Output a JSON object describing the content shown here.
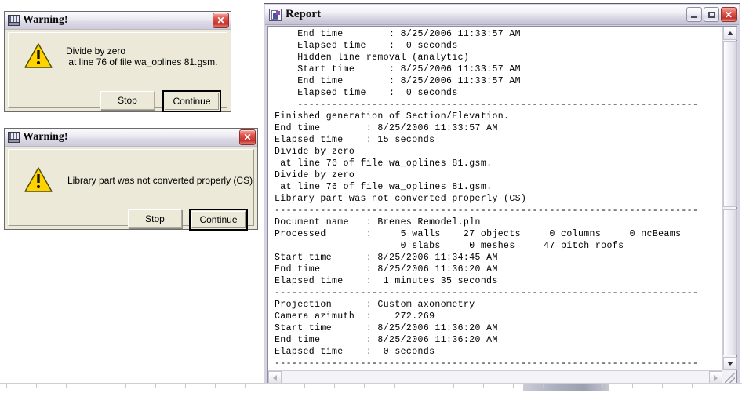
{
  "colors": {
    "dialog_face": "#ece9d8",
    "close_red": "#c5332b",
    "warning_yellow": "#ffd200",
    "titlebar_top": "#fbfbfd",
    "titlebar_bottom": "#cdcbd9",
    "text": "#000000"
  },
  "dialogs": [
    {
      "title": "Warning!",
      "icon": "library-book-icon",
      "close_label": "✕",
      "message": "Divide by zero\n at line 76 of file wa_oplines 81.gsm.",
      "alert_icon": "warning-triangle-icon",
      "buttons": [
        {
          "label": "Stop",
          "default": false
        },
        {
          "label": "Continue",
          "default": true
        }
      ]
    },
    {
      "title": "Warning!",
      "icon": "library-book-icon",
      "close_label": "✕",
      "message": "Library part was not converted properly (CS)",
      "alert_icon": "warning-triangle-icon",
      "buttons": [
        {
          "label": "Stop",
          "default": false
        },
        {
          "label": "Continue",
          "default": true
        }
      ]
    }
  ],
  "report_window": {
    "title": "Report",
    "icon": "report-document-icon",
    "window_buttons": {
      "minimize_label": "–",
      "maximize_label": "□",
      "close_label": "✕"
    },
    "scrollbars": {
      "vertical": {
        "up_label": "▲",
        "down_label": "▼"
      },
      "horizontal": {
        "left_label": "◀",
        "right_label": "▶"
      }
    },
    "content": "    End time        : 8/25/2006 11:33:57 AM\n    Elapsed time    :  0 seconds\n    Hidden line removal (analytic)\n    Start time      : 8/25/2006 11:33:57 AM\n    End time        : 8/25/2006 11:33:57 AM\n    Elapsed time    :  0 seconds\n    ----------------------------------------------------------------------\nFinished generation of Section/Elevation.\nEnd time        : 8/25/2006 11:33:57 AM\nElapsed time    : 15 seconds\nDivide by zero\n at line 76 of file wa_oplines 81.gsm.\nDivide by zero\n at line 76 of file wa_oplines 81.gsm.\nLibrary part was not converted properly (CS)\n--------------------------------------------------------------------------\nDocument name   : Brenes Remodel.pln\nProcessed       :     5 walls    27 objects     0 columns     0 ncBeams\n                      0 slabs     0 meshes     47 pitch roofs\nStart time      : 8/25/2006 11:34:45 AM\nEnd time        : 8/25/2006 11:36:20 AM\nElapsed time    :  1 minutes 35 seconds\n--------------------------------------------------------------------------\nProjection      : Custom axonometry\nCamera azimuth  :    272.269\nStart time      : 8/25/2006 11:36:20 AM\nEnd time        : 8/25/2006 11:36:20 AM\nElapsed time    :  0 seconds\n--------------------------------------------------------------------------"
  }
}
